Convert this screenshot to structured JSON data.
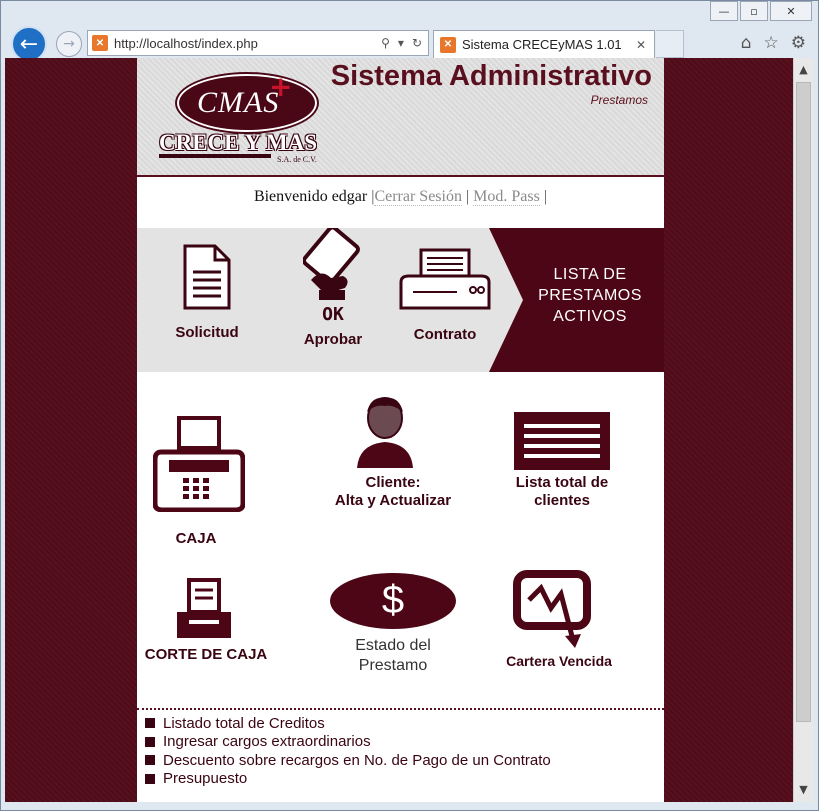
{
  "browser": {
    "url": "http://localhost/index.php",
    "tab_title": "Sistema CRECEyMAS 1.01",
    "tab_favicon": "xampp-favicon-icon"
  },
  "header": {
    "logo_main": "CMAS",
    "logo_name": "CRECE Y MAS",
    "logo_sub": "S.A. de C.V.",
    "title": "Sistema Administrativo",
    "subtitle": "Prestamos"
  },
  "welcome": {
    "text": "Bienvenido edgar",
    "sep1": "|",
    "logout": "Cerrar Sesión",
    "sep2": "|",
    "change_pass": "Mod. Pass",
    "sep3": "|"
  },
  "process": {
    "solicitud": "Solicitud",
    "aprobar": "Aprobar",
    "ok_badge": "OK",
    "contrato": "Contrato",
    "lista_line1": "LISTA DE",
    "lista_line2": "PRESTAMOS",
    "lista_line3": "ACTIVOS"
  },
  "menu": {
    "caja": "CAJA",
    "cliente_line1": "Cliente:",
    "cliente_line2": "Alta y Actualizar",
    "lista_line1": "Lista total de",
    "lista_line2": "clientes",
    "corte": "CORTE DE CAJA",
    "estado_line1": "Estado del",
    "estado_line2": "Prestamo",
    "dollar": "$",
    "cartera": "Cartera Vencida"
  },
  "links": [
    "Listado total de Creditos",
    "Ingresar cargos extraordinarios",
    "Descuento sobre recargos en No. de Pago de un Contrato",
    "Presupuesto"
  ],
  "colors": {
    "brand_maroon": "#4d0616",
    "page_bg": "#5a0f1e"
  }
}
